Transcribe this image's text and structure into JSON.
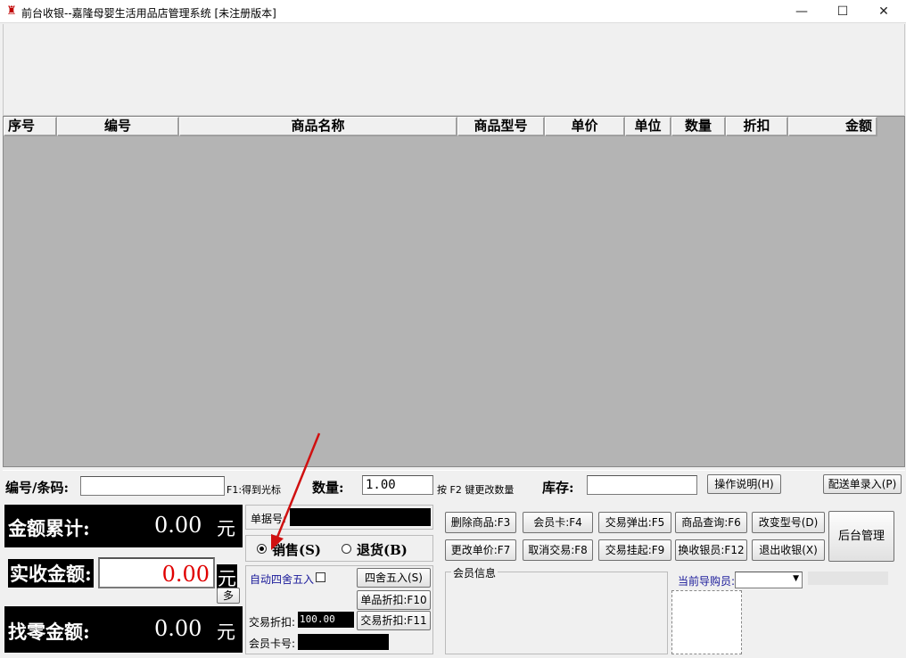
{
  "window": {
    "title": "前台收银--嘉隆母婴生活用品店管理系统 [未注册版本]",
    "minimize": "—",
    "maximize": "☐",
    "close": "✕"
  },
  "grid": {
    "columns": [
      "序号",
      "编号",
      "商品名称",
      "商品型号",
      "单价",
      "单位",
      "数量",
      "折扣",
      "金额"
    ]
  },
  "entry": {
    "code_label": "编号/条码:",
    "code_value": "",
    "f1_hint": "F1:得到光标",
    "qty_label": "数量:",
    "qty_value": "1.00",
    "f2_hint": "按 F2 键更改数量",
    "stock_label": "库存:",
    "stock_value": "",
    "help_button": "操作说明(H)",
    "delivery_button": "配送单录入(P)"
  },
  "totals": {
    "total_label": "金额累计:",
    "total_value": "0.00",
    "total_unit": "元",
    "received_label": "实收金额:",
    "received_value": "0.00",
    "received_unit": "元",
    "multi_button": "多",
    "change_label": "找零金额:",
    "change_value": "0.00",
    "change_unit": "元"
  },
  "middle": {
    "receipt_label": "单据号:",
    "sale_radio": "销售(S)",
    "return_radio": "退货(B)",
    "auto_round_label": "自动四舍五入",
    "round_button": "四舍五入(S)",
    "item_discount_button": "单品折扣:F10",
    "txn_discount_label": "交易折扣:",
    "txn_discount_value": "100.00",
    "txn_discount_button": "交易折扣:F11",
    "member_card_label": "会员卡号:"
  },
  "actions": {
    "row1": [
      "删除商品:F3",
      "会员卡:F4",
      "交易弹出:F5",
      "商品查询:F6",
      "改变型号(D)"
    ],
    "row2": [
      "更改单价:F7",
      "取消交易:F8",
      "交易挂起:F9",
      "换收银员:F12",
      "退出收银(X)"
    ],
    "backend_button": "后台管理",
    "member_info_legend": "会员信息",
    "guide_label": "当前导购员:"
  },
  "colors": {
    "accent_red": "#e00000",
    "grid_bg": "#b4b4b4",
    "black_panel": "#000000"
  }
}
